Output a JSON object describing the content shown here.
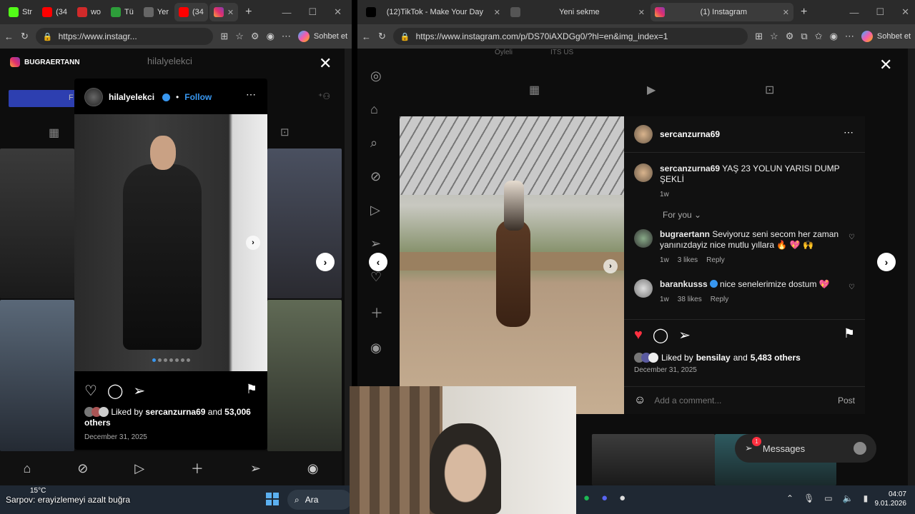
{
  "left_window": {
    "tabs": [
      {
        "label": "Str",
        "icon": "k-icon",
        "color": "#53fc18"
      },
      {
        "label": "(34",
        "icon": "youtube-icon",
        "color": "#ff0000"
      },
      {
        "label": "wo",
        "icon": "y-icon",
        "color": "#d12a2a"
      },
      {
        "label": "Tü",
        "icon": "w-icon",
        "color": "#2d9e3a"
      },
      {
        "label": "Yer",
        "icon": "page-icon",
        "color": "#666666"
      },
      {
        "label": "(34",
        "icon": "youtube-icon",
        "color": "#ff0000"
      }
    ],
    "url": "https://www.instagr...",
    "sohbet": "Sohbet et",
    "profile_badge": "BUGRAERTANN",
    "bg_username": "hilalyelekci",
    "bg_follow": "F",
    "post": {
      "username": "hilalyelekci",
      "follow": "Follow",
      "liked_prefix": "Liked by",
      "liked_user": "sercanzurna69",
      "liked_and": "and",
      "liked_count": "53,006",
      "liked_others": "others",
      "date": "December 31, 2025"
    }
  },
  "right_window": {
    "tabs": [
      {
        "label": "(12)TikTok - Make Your Day",
        "icon": "tiktok-icon"
      },
      {
        "label": "Yeni sekme",
        "icon": "page-icon"
      },
      {
        "label": "(1) Instagram",
        "icon": "instagram-icon"
      }
    ],
    "url": "https://www.instagram.com/p/DS70iAXDGg0/?hl=en&img_index=1",
    "sohbet": "Sohbet et",
    "bg_header_a": "Öyleli",
    "bg_header_b": "ITS US",
    "post": {
      "username": "sercanzurna69",
      "caption_user": "sercanzurna69",
      "caption_text": "YAŞ 23 YOLUN YARISI DUMP ŞEKLİ",
      "caption_time": "1w",
      "for_you": "For you",
      "comments": [
        {
          "user": "bugraertann",
          "text": "Seviyoruz seni secom her zaman yanınızdayiz nice mutlu yıllara 🔥 💖 🙌",
          "time": "1w",
          "likes": "3 likes",
          "reply": "Reply"
        },
        {
          "user": "barankusss",
          "text": "nice senelerimize dostum 💖",
          "time": "1w",
          "likes": "38 likes",
          "reply": "Reply"
        }
      ],
      "liked_prefix": "Liked by",
      "liked_user": "bensilay",
      "liked_and": "and",
      "liked_count": "5,483 others",
      "date": "December 31, 2025",
      "add_comment_placeholder": "Add a comment...",
      "post_label": "Post"
    },
    "messages_label": "Messages",
    "messages_badge": "1"
  },
  "taskbar": {
    "weather_temp": "15°C",
    "stream_text_1": "Sarpov: erayizlemeyi azalt buğra",
    "search_placeholder": "Ara",
    "time": "04:07",
    "date": "9.01.2026"
  }
}
